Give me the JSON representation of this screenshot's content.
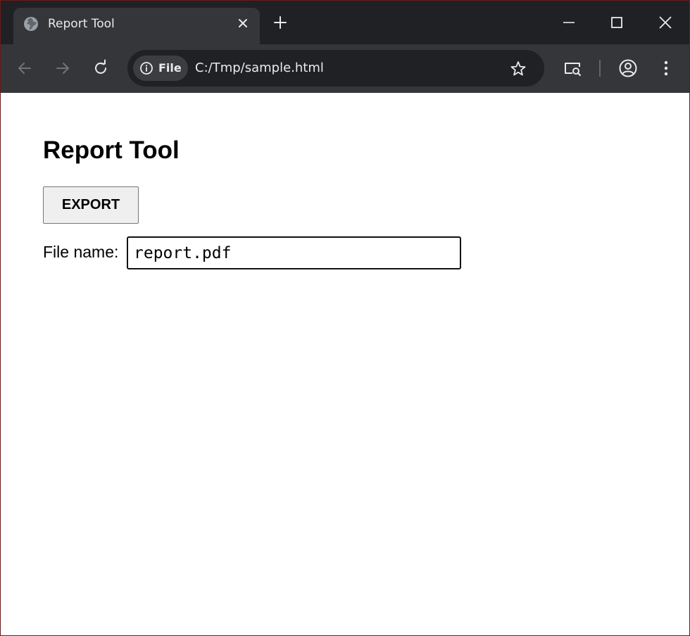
{
  "browser": {
    "tab_title": "Report Tool",
    "security_chip_label": "File",
    "address": "C:/Tmp/sample.html",
    "icons": {
      "favicon": "globe-icon",
      "tab_close": "close-icon",
      "new_tab": "plus-icon",
      "minimize": "minimize-icon",
      "maximize": "maximize-icon",
      "close_window": "close-icon",
      "back": "arrow-left-icon",
      "forward": "arrow-right-icon",
      "reload": "reload-icon",
      "info": "info-icon",
      "bookmark": "star-icon",
      "search_tabs": "tab-search-icon",
      "profile": "account-circle-icon",
      "menu": "kebab-menu-icon"
    },
    "colors": {
      "tabstrip": "#202124",
      "toolbar": "#35363a",
      "omnibox": "#202124",
      "text": "#e8eaed"
    }
  },
  "page": {
    "title": "Report Tool",
    "export_label": "EXPORT",
    "file_name_label": "File name:",
    "file_name_value": "report.pdf"
  }
}
